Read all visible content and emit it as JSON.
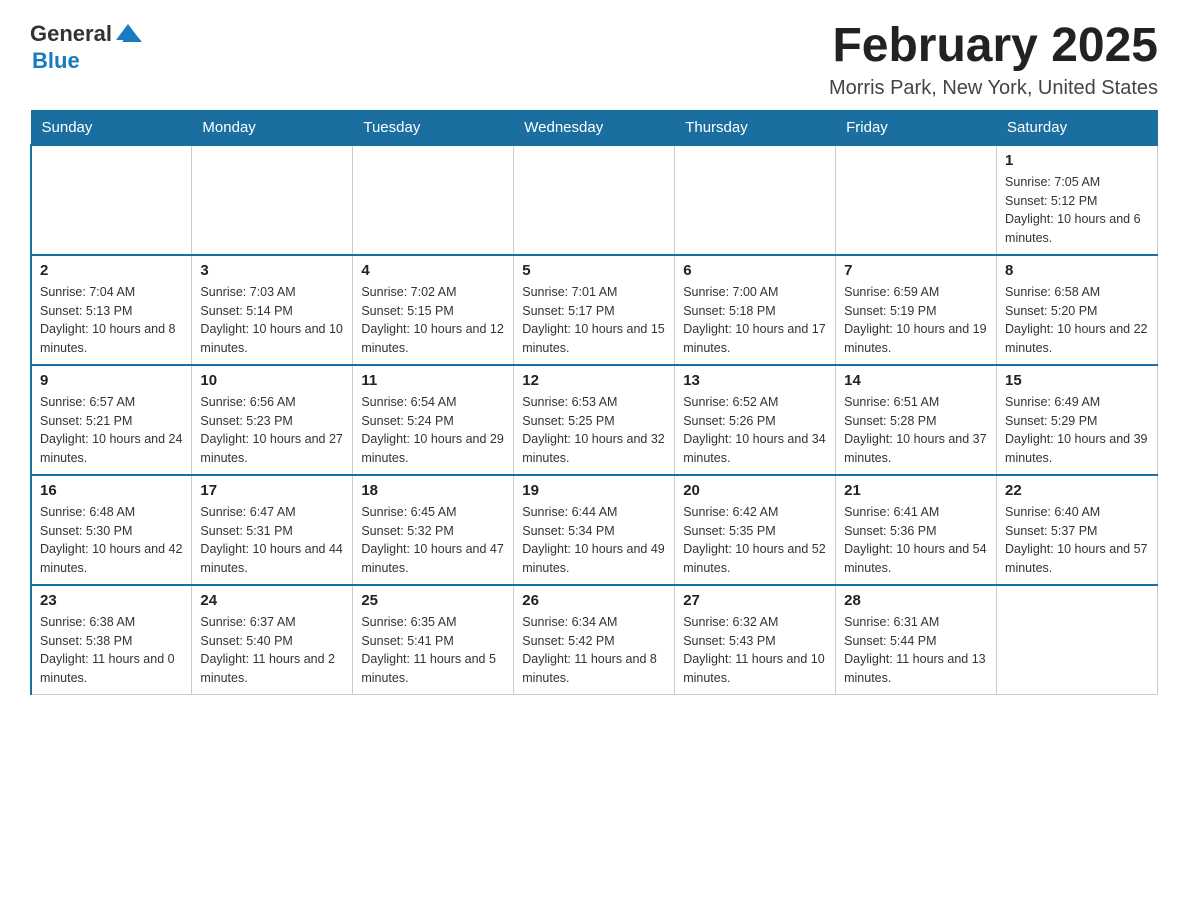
{
  "header": {
    "logo": {
      "text_general": "General",
      "text_blue": "Blue",
      "aria": "GeneralBlue logo"
    },
    "title": "February 2025",
    "subtitle": "Morris Park, New York, United States"
  },
  "days_of_week": [
    "Sunday",
    "Monday",
    "Tuesday",
    "Wednesday",
    "Thursday",
    "Friday",
    "Saturday"
  ],
  "weeks": [
    [
      {
        "day": "",
        "sunrise": "",
        "sunset": "",
        "daylight": "",
        "empty": true
      },
      {
        "day": "",
        "sunrise": "",
        "sunset": "",
        "daylight": "",
        "empty": true
      },
      {
        "day": "",
        "sunrise": "",
        "sunset": "",
        "daylight": "",
        "empty": true
      },
      {
        "day": "",
        "sunrise": "",
        "sunset": "",
        "daylight": "",
        "empty": true
      },
      {
        "day": "",
        "sunrise": "",
        "sunset": "",
        "daylight": "",
        "empty": true
      },
      {
        "day": "",
        "sunrise": "",
        "sunset": "",
        "daylight": "",
        "empty": true
      },
      {
        "day": "1",
        "sunrise": "Sunrise: 7:05 AM",
        "sunset": "Sunset: 5:12 PM",
        "daylight": "Daylight: 10 hours and 6 minutes.",
        "empty": false
      }
    ],
    [
      {
        "day": "2",
        "sunrise": "Sunrise: 7:04 AM",
        "sunset": "Sunset: 5:13 PM",
        "daylight": "Daylight: 10 hours and 8 minutes.",
        "empty": false
      },
      {
        "day": "3",
        "sunrise": "Sunrise: 7:03 AM",
        "sunset": "Sunset: 5:14 PM",
        "daylight": "Daylight: 10 hours and 10 minutes.",
        "empty": false
      },
      {
        "day": "4",
        "sunrise": "Sunrise: 7:02 AM",
        "sunset": "Sunset: 5:15 PM",
        "daylight": "Daylight: 10 hours and 12 minutes.",
        "empty": false
      },
      {
        "day": "5",
        "sunrise": "Sunrise: 7:01 AM",
        "sunset": "Sunset: 5:17 PM",
        "daylight": "Daylight: 10 hours and 15 minutes.",
        "empty": false
      },
      {
        "day": "6",
        "sunrise": "Sunrise: 7:00 AM",
        "sunset": "Sunset: 5:18 PM",
        "daylight": "Daylight: 10 hours and 17 minutes.",
        "empty": false
      },
      {
        "day": "7",
        "sunrise": "Sunrise: 6:59 AM",
        "sunset": "Sunset: 5:19 PM",
        "daylight": "Daylight: 10 hours and 19 minutes.",
        "empty": false
      },
      {
        "day": "8",
        "sunrise": "Sunrise: 6:58 AM",
        "sunset": "Sunset: 5:20 PM",
        "daylight": "Daylight: 10 hours and 22 minutes.",
        "empty": false
      }
    ],
    [
      {
        "day": "9",
        "sunrise": "Sunrise: 6:57 AM",
        "sunset": "Sunset: 5:21 PM",
        "daylight": "Daylight: 10 hours and 24 minutes.",
        "empty": false
      },
      {
        "day": "10",
        "sunrise": "Sunrise: 6:56 AM",
        "sunset": "Sunset: 5:23 PM",
        "daylight": "Daylight: 10 hours and 27 minutes.",
        "empty": false
      },
      {
        "day": "11",
        "sunrise": "Sunrise: 6:54 AM",
        "sunset": "Sunset: 5:24 PM",
        "daylight": "Daylight: 10 hours and 29 minutes.",
        "empty": false
      },
      {
        "day": "12",
        "sunrise": "Sunrise: 6:53 AM",
        "sunset": "Sunset: 5:25 PM",
        "daylight": "Daylight: 10 hours and 32 minutes.",
        "empty": false
      },
      {
        "day": "13",
        "sunrise": "Sunrise: 6:52 AM",
        "sunset": "Sunset: 5:26 PM",
        "daylight": "Daylight: 10 hours and 34 minutes.",
        "empty": false
      },
      {
        "day": "14",
        "sunrise": "Sunrise: 6:51 AM",
        "sunset": "Sunset: 5:28 PM",
        "daylight": "Daylight: 10 hours and 37 minutes.",
        "empty": false
      },
      {
        "day": "15",
        "sunrise": "Sunrise: 6:49 AM",
        "sunset": "Sunset: 5:29 PM",
        "daylight": "Daylight: 10 hours and 39 minutes.",
        "empty": false
      }
    ],
    [
      {
        "day": "16",
        "sunrise": "Sunrise: 6:48 AM",
        "sunset": "Sunset: 5:30 PM",
        "daylight": "Daylight: 10 hours and 42 minutes.",
        "empty": false
      },
      {
        "day": "17",
        "sunrise": "Sunrise: 6:47 AM",
        "sunset": "Sunset: 5:31 PM",
        "daylight": "Daylight: 10 hours and 44 minutes.",
        "empty": false
      },
      {
        "day": "18",
        "sunrise": "Sunrise: 6:45 AM",
        "sunset": "Sunset: 5:32 PM",
        "daylight": "Daylight: 10 hours and 47 minutes.",
        "empty": false
      },
      {
        "day": "19",
        "sunrise": "Sunrise: 6:44 AM",
        "sunset": "Sunset: 5:34 PM",
        "daylight": "Daylight: 10 hours and 49 minutes.",
        "empty": false
      },
      {
        "day": "20",
        "sunrise": "Sunrise: 6:42 AM",
        "sunset": "Sunset: 5:35 PM",
        "daylight": "Daylight: 10 hours and 52 minutes.",
        "empty": false
      },
      {
        "day": "21",
        "sunrise": "Sunrise: 6:41 AM",
        "sunset": "Sunset: 5:36 PM",
        "daylight": "Daylight: 10 hours and 54 minutes.",
        "empty": false
      },
      {
        "day": "22",
        "sunrise": "Sunrise: 6:40 AM",
        "sunset": "Sunset: 5:37 PM",
        "daylight": "Daylight: 10 hours and 57 minutes.",
        "empty": false
      }
    ],
    [
      {
        "day": "23",
        "sunrise": "Sunrise: 6:38 AM",
        "sunset": "Sunset: 5:38 PM",
        "daylight": "Daylight: 11 hours and 0 minutes.",
        "empty": false
      },
      {
        "day": "24",
        "sunrise": "Sunrise: 6:37 AM",
        "sunset": "Sunset: 5:40 PM",
        "daylight": "Daylight: 11 hours and 2 minutes.",
        "empty": false
      },
      {
        "day": "25",
        "sunrise": "Sunrise: 6:35 AM",
        "sunset": "Sunset: 5:41 PM",
        "daylight": "Daylight: 11 hours and 5 minutes.",
        "empty": false
      },
      {
        "day": "26",
        "sunrise": "Sunrise: 6:34 AM",
        "sunset": "Sunset: 5:42 PM",
        "daylight": "Daylight: 11 hours and 8 minutes.",
        "empty": false
      },
      {
        "day": "27",
        "sunrise": "Sunrise: 6:32 AM",
        "sunset": "Sunset: 5:43 PM",
        "daylight": "Daylight: 11 hours and 10 minutes.",
        "empty": false
      },
      {
        "day": "28",
        "sunrise": "Sunrise: 6:31 AM",
        "sunset": "Sunset: 5:44 PM",
        "daylight": "Daylight: 11 hours and 13 minutes.",
        "empty": false
      },
      {
        "day": "",
        "sunrise": "",
        "sunset": "",
        "daylight": "",
        "empty": true
      }
    ]
  ],
  "colors": {
    "header_bg": "#1a6fa0",
    "header_text": "#ffffff",
    "border": "#ccc",
    "accent": "#1a7abf"
  }
}
